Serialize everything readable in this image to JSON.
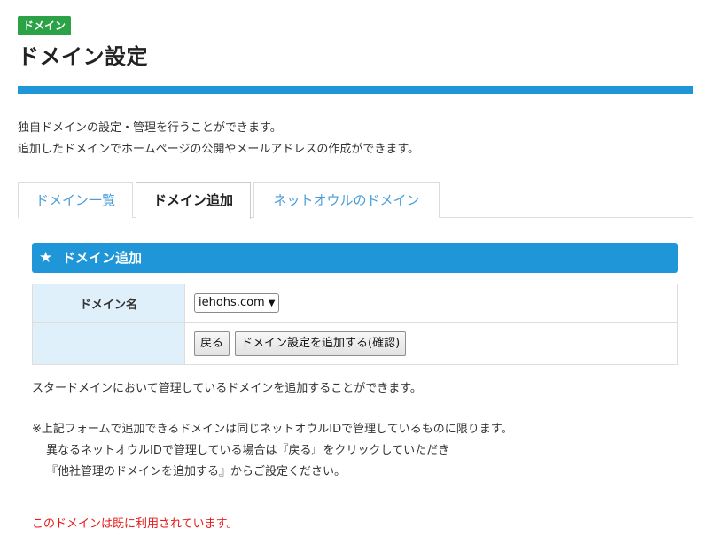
{
  "header": {
    "badge": "ドメイン",
    "title": "ドメイン設定"
  },
  "description": [
    "独自ドメインの設定・管理を行うことができます。",
    "追加したドメインでホームページの公開やメールアドレスの作成ができます。"
  ],
  "tabs": [
    {
      "label": "ドメイン一覧"
    },
    {
      "label": "ドメイン追加"
    },
    {
      "label": "ネットオウルのドメイン"
    }
  ],
  "panel": {
    "icon": "star-icon",
    "title": "ドメイン追加"
  },
  "form": {
    "domain_label": "ドメイン名",
    "domain_selected": "iehohs.com",
    "back_button": "戻る",
    "submit_button": "ドメイン設定を追加する(確認)"
  },
  "info_text": "スタードメインにおいて管理しているドメインを追加することができます。",
  "note": [
    "※上記フォームで追加できるドメインは同じネットオウルIDで管理しているものに限ります。",
    "異なるネットオウルIDで管理している場合は『戻る』をクリックしていただき",
    "『他社管理のドメインを追加する』からご設定ください。"
  ],
  "error_text": "このドメインは既に利用されています。",
  "colors": {
    "accent": "#1e96d8",
    "badge": "#2aa245",
    "error": "#e61919",
    "table_header": "#dff0fb"
  }
}
